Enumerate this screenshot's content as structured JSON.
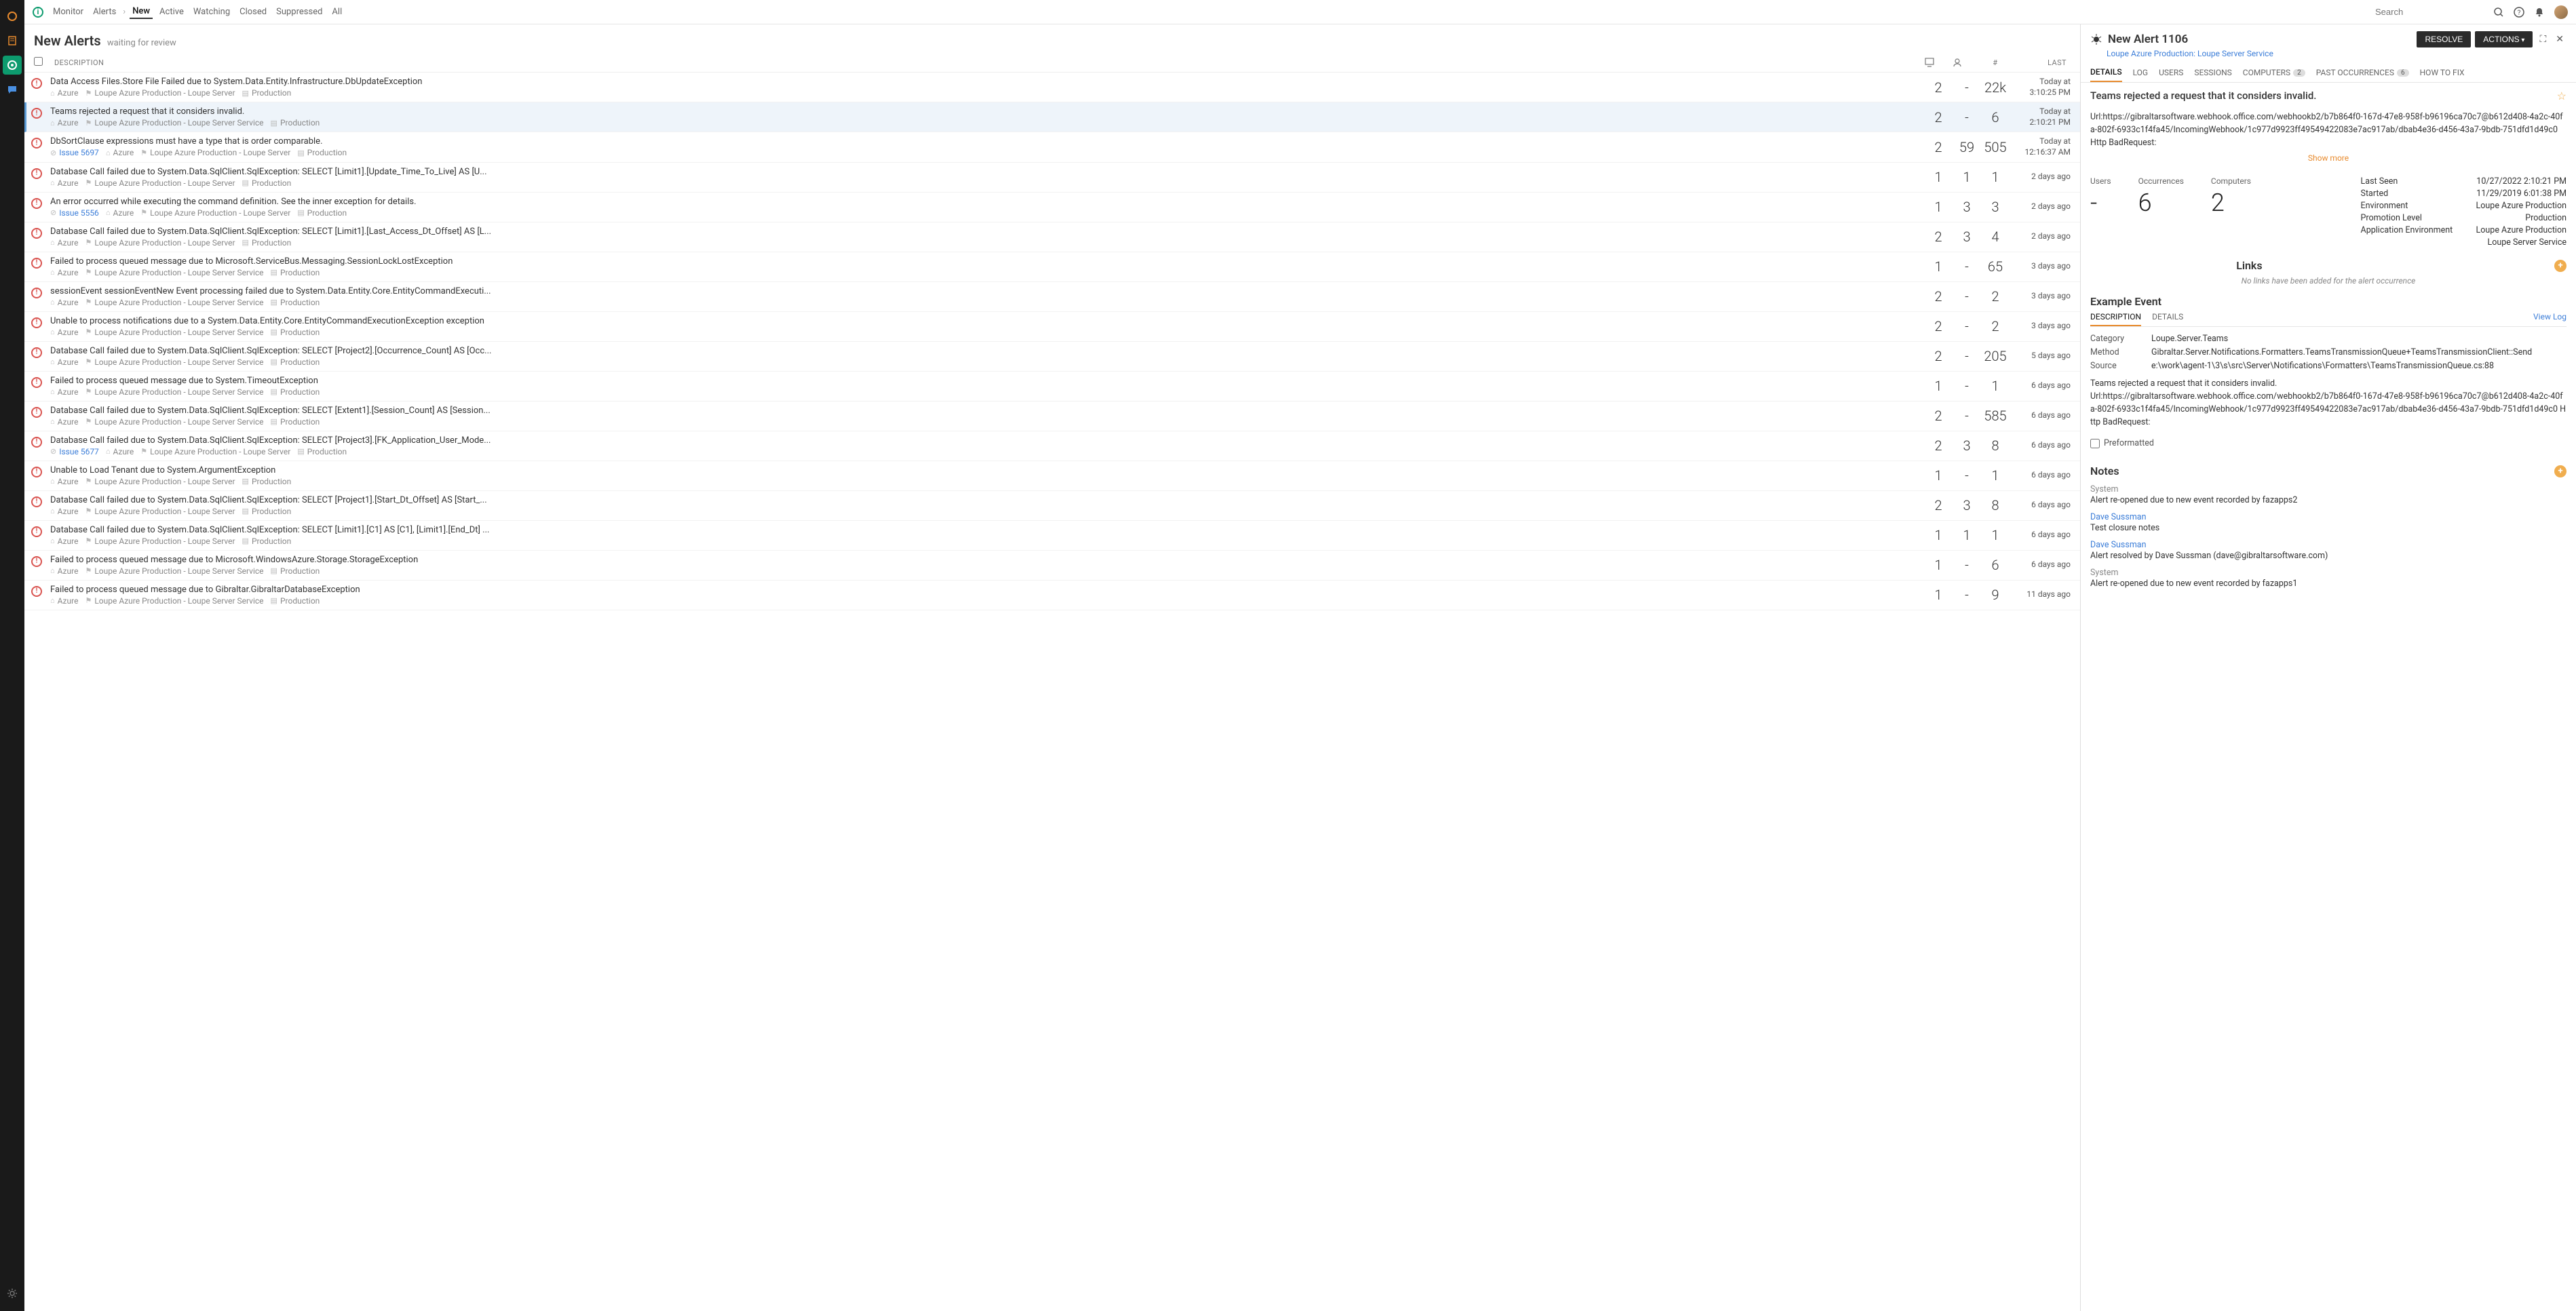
{
  "topbar": {
    "monitor": "Monitor",
    "alerts": "Alerts",
    "new": "New",
    "active": "Active",
    "watching": "Watching",
    "closed": "Closed",
    "suppressed": "Suppressed",
    "all": "All",
    "search_placeholder": "Search"
  },
  "page": {
    "title": "New Alerts",
    "subtitle": "waiting for review"
  },
  "columns": {
    "description": "DESCRIPTION",
    "last": "LAST"
  },
  "alerts": [
    {
      "title": "Data Access Files.Store File Failed due to System.Data.Entity.Infrastructure.DbUpdateException",
      "issue": null,
      "tenant": "Azure",
      "app": "Loupe Azure Production - Loupe Server",
      "env": "Production",
      "c1": "2",
      "c2": "-",
      "c3": "22k",
      "last1": "Today at",
      "last2": "3:10:25 PM",
      "selected": false
    },
    {
      "title": "Teams rejected a request that it considers invalid.",
      "issue": null,
      "tenant": "Azure",
      "app": "Loupe Azure Production - Loupe Server Service",
      "env": "Production",
      "c1": "2",
      "c2": "-",
      "c3": "6",
      "last1": "Today at",
      "last2": "2:10:21 PM",
      "selected": true
    },
    {
      "title": "DbSortClause expressions must have a type that is order comparable.",
      "issue": "Issue 5697",
      "tenant": "Azure",
      "app": "Loupe Azure Production - Loupe Server",
      "env": "Production",
      "c1": "2",
      "c2": "59",
      "c3": "505",
      "last1": "Today at",
      "last2": "12:16:37 AM",
      "selected": false
    },
    {
      "title": "Database Call failed due to System.Data.SqlClient.SqlException: SELECT [Limit1].[Update_Time_To_Live] AS [U...",
      "issue": null,
      "tenant": "Azure",
      "app": "Loupe Azure Production - Loupe Server",
      "env": "Production",
      "c1": "1",
      "c2": "1",
      "c3": "1",
      "last1": "",
      "last2": "2 days ago",
      "selected": false
    },
    {
      "title": "An error occurred while executing the command definition. See the inner exception for details.",
      "issue": "Issue 5556",
      "tenant": "Azure",
      "app": "Loupe Azure Production - Loupe Server",
      "env": "Production",
      "c1": "1",
      "c2": "3",
      "c3": "3",
      "last1": "",
      "last2": "2 days ago",
      "selected": false
    },
    {
      "title": "Database Call failed due to System.Data.SqlClient.SqlException: SELECT [Limit1].[Last_Access_Dt_Offset] AS [L...",
      "issue": null,
      "tenant": "Azure",
      "app": "Loupe Azure Production - Loupe Server",
      "env": "Production",
      "c1": "2",
      "c2": "3",
      "c3": "4",
      "last1": "",
      "last2": "2 days ago",
      "selected": false
    },
    {
      "title": "Failed to process queued message due to Microsoft.ServiceBus.Messaging.SessionLockLostException",
      "issue": null,
      "tenant": "Azure",
      "app": "Loupe Azure Production - Loupe Server Service",
      "env": "Production",
      "c1": "1",
      "c2": "-",
      "c3": "65",
      "last1": "",
      "last2": "3 days ago",
      "selected": false
    },
    {
      "title": "sessionEvent sessionEventNew Event processing failed due to System.Data.Entity.Core.EntityCommandExecuti...",
      "issue": null,
      "tenant": "Azure",
      "app": "Loupe Azure Production - Loupe Server Service",
      "env": "Production",
      "c1": "2",
      "c2": "-",
      "c3": "2",
      "last1": "",
      "last2": "3 days ago",
      "selected": false
    },
    {
      "title": "Unable to process notifications due to a System.Data.Entity.Core.EntityCommandExecutionException exception",
      "issue": null,
      "tenant": "Azure",
      "app": "Loupe Azure Production - Loupe Server Service",
      "env": "Production",
      "c1": "2",
      "c2": "-",
      "c3": "2",
      "last1": "",
      "last2": "3 days ago",
      "selected": false
    },
    {
      "title": "Database Call failed due to System.Data.SqlClient.SqlException: SELECT [Project2].[Occurrence_Count] AS [Occ...",
      "issue": null,
      "tenant": "Azure",
      "app": "Loupe Azure Production - Loupe Server Service",
      "env": "Production",
      "c1": "2",
      "c2": "-",
      "c3": "205",
      "last1": "",
      "last2": "5 days ago",
      "selected": false
    },
    {
      "title": "Failed to process queued message due to System.TimeoutException",
      "issue": null,
      "tenant": "Azure",
      "app": "Loupe Azure Production - Loupe Server Service",
      "env": "Production",
      "c1": "1",
      "c2": "-",
      "c3": "1",
      "last1": "",
      "last2": "6 days ago",
      "selected": false
    },
    {
      "title": "Database Call failed due to System.Data.SqlClient.SqlException: SELECT [Extent1].[Session_Count] AS [Session...",
      "issue": null,
      "tenant": "Azure",
      "app": "Loupe Azure Production - Loupe Server Service",
      "env": "Production",
      "c1": "2",
      "c2": "-",
      "c3": "585",
      "last1": "",
      "last2": "6 days ago",
      "selected": false
    },
    {
      "title": "Database Call failed due to System.Data.SqlClient.SqlException: SELECT [Project3].[FK_Application_User_Mode...",
      "issue": "Issue 5677",
      "tenant": "Azure",
      "app": "Loupe Azure Production - Loupe Server",
      "env": "Production",
      "c1": "2",
      "c2": "3",
      "c3": "8",
      "last1": "",
      "last2": "6 days ago",
      "selected": false
    },
    {
      "title": "Unable to Load Tenant due to System.ArgumentException",
      "issue": null,
      "tenant": "Azure",
      "app": "Loupe Azure Production - Loupe Server",
      "env": "Production",
      "c1": "1",
      "c2": "-",
      "c3": "1",
      "last1": "",
      "last2": "6 days ago",
      "selected": false
    },
    {
      "title": "Database Call failed due to System.Data.SqlClient.SqlException: SELECT [Project1].[Start_Dt_Offset] AS [Start_...",
      "issue": null,
      "tenant": "Azure",
      "app": "Loupe Azure Production - Loupe Server",
      "env": "Production",
      "c1": "2",
      "c2": "3",
      "c3": "8",
      "last1": "",
      "last2": "6 days ago",
      "selected": false
    },
    {
      "title": "Database Call failed due to System.Data.SqlClient.SqlException: SELECT [Limit1].[C1] AS [C1], [Limit1].[End_Dt] ...",
      "issue": null,
      "tenant": "Azure",
      "app": "Loupe Azure Production - Loupe Server",
      "env": "Production",
      "c1": "1",
      "c2": "1",
      "c3": "1",
      "last1": "",
      "last2": "6 days ago",
      "selected": false
    },
    {
      "title": "Failed to process queued message due to Microsoft.WindowsAzure.Storage.StorageException",
      "issue": null,
      "tenant": "Azure",
      "app": "Loupe Azure Production - Loupe Server Service",
      "env": "Production",
      "c1": "1",
      "c2": "-",
      "c3": "6",
      "last1": "",
      "last2": "6 days ago",
      "selected": false
    },
    {
      "title": "Failed to process queued message due to Gibraltar.GibraltarDatabaseException",
      "issue": null,
      "tenant": "Azure",
      "app": "Loupe Azure Production - Loupe Server Service",
      "env": "Production",
      "c1": "1",
      "c2": "-",
      "c3": "9",
      "last1": "",
      "last2": "11 days ago",
      "selected": false
    }
  ],
  "detail": {
    "title": "New Alert 1106",
    "subtitle": "Loupe Azure Production: Loupe Server Service",
    "resolve": "RESOLVE",
    "actions": "ACTIONS",
    "tabs": {
      "details": "DETAILS",
      "log": "LOG",
      "users": "USERS",
      "sessions": "SESSIONS",
      "computers": "COMPUTERS",
      "computers_badge": "2",
      "past": "PAST OCCURRENCES",
      "past_badge": "6",
      "howto": "HOW TO FIX"
    },
    "summary_title": "Teams rejected a request that it considers invalid.",
    "url_block": "Url:https://gibraltarsoftware.webhook.office.com/webhookb2/b7b864f0-167d-47e8-958f-b96196ca70c7@b612d408-4a2c-40fa-802f-6933c1f4fa45/IncomingWebhook/1c977d9923ff49549422083e7ac917ab/dbab4e36-d456-43a7-9bdb-751dfd1d49c0\nHttp BadRequest:",
    "show_more": "Show more",
    "stats": {
      "users_label": "Users",
      "users_value": "-",
      "occ_label": "Occurrences",
      "occ_value": "6",
      "comp_label": "Computers",
      "comp_value": "2"
    },
    "facts": [
      {
        "l": "Last Seen",
        "v": "10/27/2022 2:10:21 PM"
      },
      {
        "l": "Started",
        "v": "11/29/2019 6:01:38 PM"
      },
      {
        "l": "Environment",
        "v": "Loupe Azure Production"
      },
      {
        "l": "Promotion Level",
        "v": "Production"
      },
      {
        "l": "Application Environment",
        "v": "Loupe Azure Production"
      },
      {
        "l": "",
        "v": "Loupe Server Service"
      }
    ],
    "links_title": "Links",
    "no_links": "No links have been added for the alert occurrence",
    "example_title": "Example Event",
    "subtabs": {
      "description": "DESCRIPTION",
      "details": "DETAILS",
      "viewlog": "View Log"
    },
    "event": {
      "category_l": "Category",
      "category_v": "Loupe.Server.Teams",
      "method_l": "Method",
      "method_v": "Gibraltar.Server.Notifications.Formatters.TeamsTransmissionQueue+TeamsTransmissionClient::Send",
      "source_l": "Source",
      "source_v": "e:\\work\\agent-1\\3\\s\\src\\Server\\Notifications\\Formatters\\TeamsTransmissionQueue.cs:88"
    },
    "desc_text": "Teams rejected a request that it considers invalid.\nUrl:https://gibraltarsoftware.webhook.office.com/webhookb2/b7b864f0-167d-47e8-958f-b96196ca70c7@b612d408-4a2c-40fa-802f-6933c1f4fa45/IncomingWebhook/1c977d9923ff49549422083e7ac917ab/dbab4e36-d456-43a7-9bdb-751dfd1d49c0 Http BadRequest:",
    "preformatted": "Preformatted",
    "notes_title": "Notes",
    "notes": [
      {
        "author": "System",
        "link": false,
        "body": "Alert re-opened due to new event recorded by fazapps2"
      },
      {
        "author": "Dave Sussman",
        "link": true,
        "body": "Test closure notes"
      },
      {
        "author": "Dave Sussman",
        "link": true,
        "body": "Alert resolved by Dave Sussman (dave@gibraltarsoftware.com)"
      },
      {
        "author": "System",
        "link": false,
        "body": "Alert re-opened due to new event recorded by fazapps1"
      }
    ]
  }
}
